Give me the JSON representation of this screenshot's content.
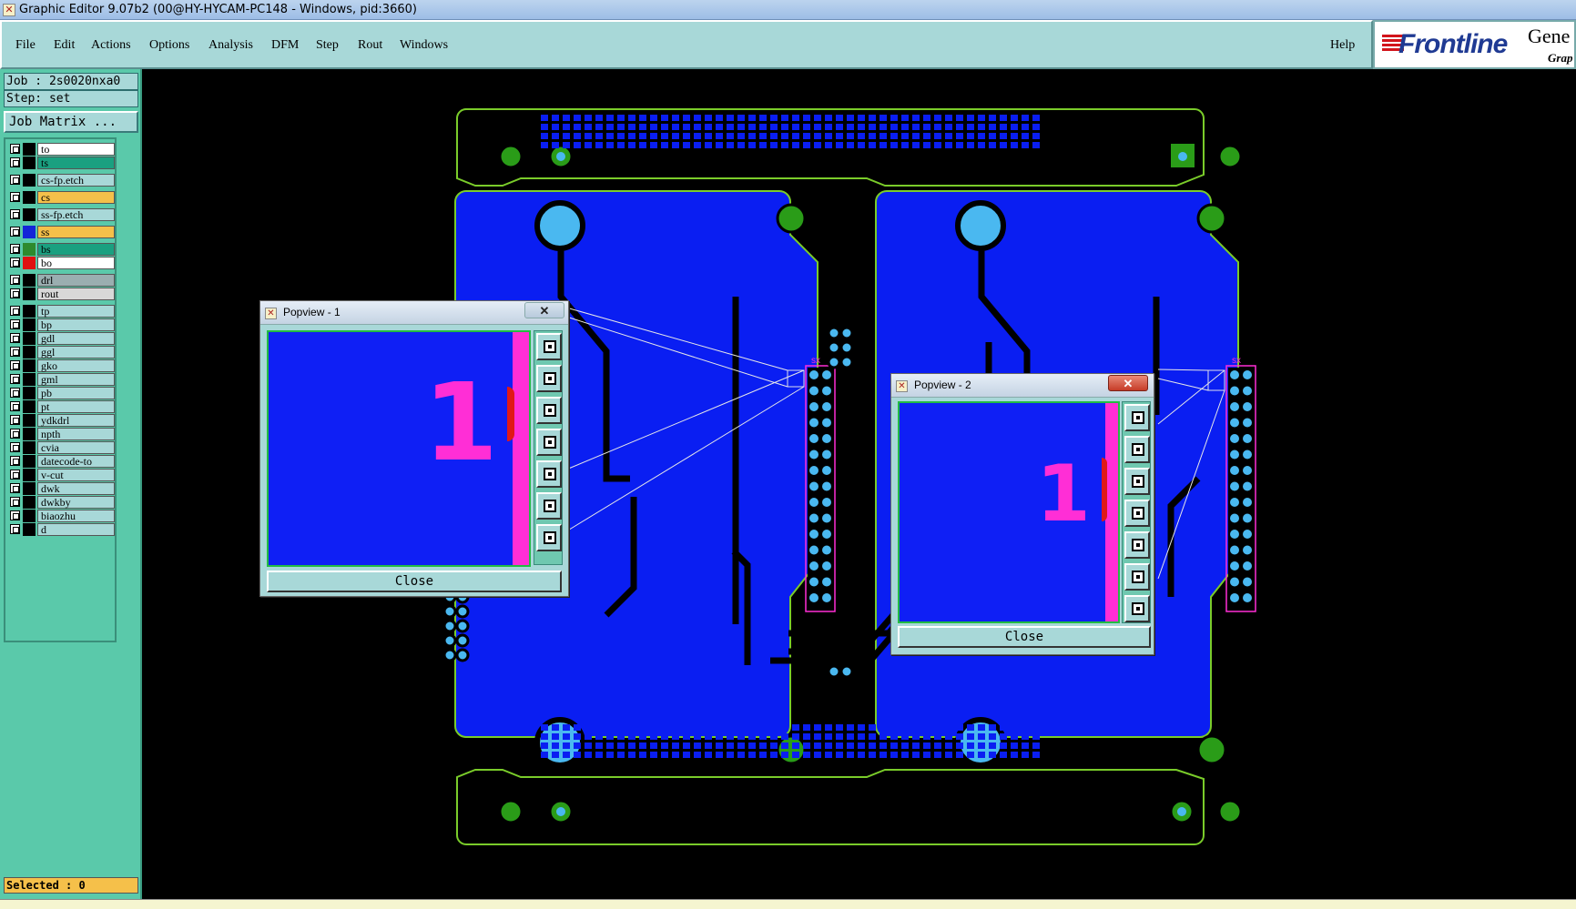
{
  "window": {
    "title": "Graphic Editor 9.07b2 (00@HY-HYCAM-PC148 - Windows, pid:3660)"
  },
  "menu": {
    "file": "File",
    "edit": "Edit",
    "actions": "Actions",
    "options": "Options",
    "analysis": "Analysis",
    "dfm": "DFM",
    "step": "Step",
    "rout": "Rout",
    "windows": "Windows",
    "help": "Help"
  },
  "logo": {
    "brand": "Frontline",
    "product": "Gene",
    "sub": "Grap"
  },
  "job": {
    "job_line": "Job : 2s0020nxa0",
    "step_line": "Step: set",
    "matrix_button": "Job Matrix ..."
  },
  "layers": [
    {
      "name": "to",
      "bg": "#ffffff",
      "swatch": "#000000"
    },
    {
      "name": "ts",
      "bg": "#1aa080",
      "swatch": "#000000"
    },
    {
      "name": "cs-fp.etch",
      "bg": "#a8d8d8",
      "swatch": "#000000"
    },
    {
      "name": "cs",
      "bg": "#f5c04a",
      "swatch": "#000000"
    },
    {
      "name": "ss-fp.etch",
      "bg": "#a8d8d8",
      "swatch": "#000000"
    },
    {
      "name": "ss",
      "bg": "#f5c04a",
      "swatch": "#1424d8"
    },
    {
      "name": "bs",
      "bg": "#1aa080",
      "swatch": "#2e8a2e"
    },
    {
      "name": "bo",
      "bg": "#ffffff",
      "swatch": "#e01010"
    },
    {
      "name": "drl",
      "bg": "#9aaeb0",
      "swatch": "#000000"
    },
    {
      "name": "rout",
      "bg": "#d8d8d8",
      "swatch": "#000000"
    },
    {
      "name": "tp",
      "bg": "#a8d8d8",
      "swatch": "#000000"
    },
    {
      "name": "bp",
      "bg": "#a8d8d8",
      "swatch": "#000000"
    },
    {
      "name": "gdl",
      "bg": "#a8d8d8",
      "swatch": "#000000"
    },
    {
      "name": "ggl",
      "bg": "#a8d8d8",
      "swatch": "#000000"
    },
    {
      "name": "gko",
      "bg": "#a8d8d8",
      "swatch": "#000000"
    },
    {
      "name": "gml",
      "bg": "#a8d8d8",
      "swatch": "#000000"
    },
    {
      "name": "pb",
      "bg": "#a8d8d8",
      "swatch": "#000000"
    },
    {
      "name": "pt",
      "bg": "#a8d8d8",
      "swatch": "#000000"
    },
    {
      "name": "ydkdrl",
      "bg": "#a8d8d8",
      "swatch": "#000000"
    },
    {
      "name": "npth",
      "bg": "#a8d8d8",
      "swatch": "#000000"
    },
    {
      "name": "cvia",
      "bg": "#a8d8d8",
      "swatch": "#000000"
    },
    {
      "name": "datecode-to",
      "bg": "#a8d8d8",
      "swatch": "#000000"
    },
    {
      "name": "v-cut",
      "bg": "#a8d8d8",
      "swatch": "#000000"
    },
    {
      "name": "dwk",
      "bg": "#a8d8d8",
      "swatch": "#000000"
    },
    {
      "name": "dwkby",
      "bg": "#a8d8d8",
      "swatch": "#000000"
    },
    {
      "name": "biaozhu",
      "bg": "#a8d8d8",
      "swatch": "#000000"
    },
    {
      "name": "d",
      "bg": "#a8d8d8",
      "swatch": "#000000"
    }
  ],
  "selected": "Selected : 0",
  "popview1": {
    "title": "Popview - 1",
    "digit": "1",
    "close": "Close"
  },
  "popview2": {
    "title": "Popview - 2",
    "digit": "1",
    "close": "Close"
  },
  "board": {
    "marker_label": "sx"
  },
  "colors": {
    "board": "#0a1ef2",
    "outline": "#7acc2a",
    "pad": "#4ab8f0",
    "fiducial": "#2a9c18",
    "marker": "#ff2ed6"
  }
}
